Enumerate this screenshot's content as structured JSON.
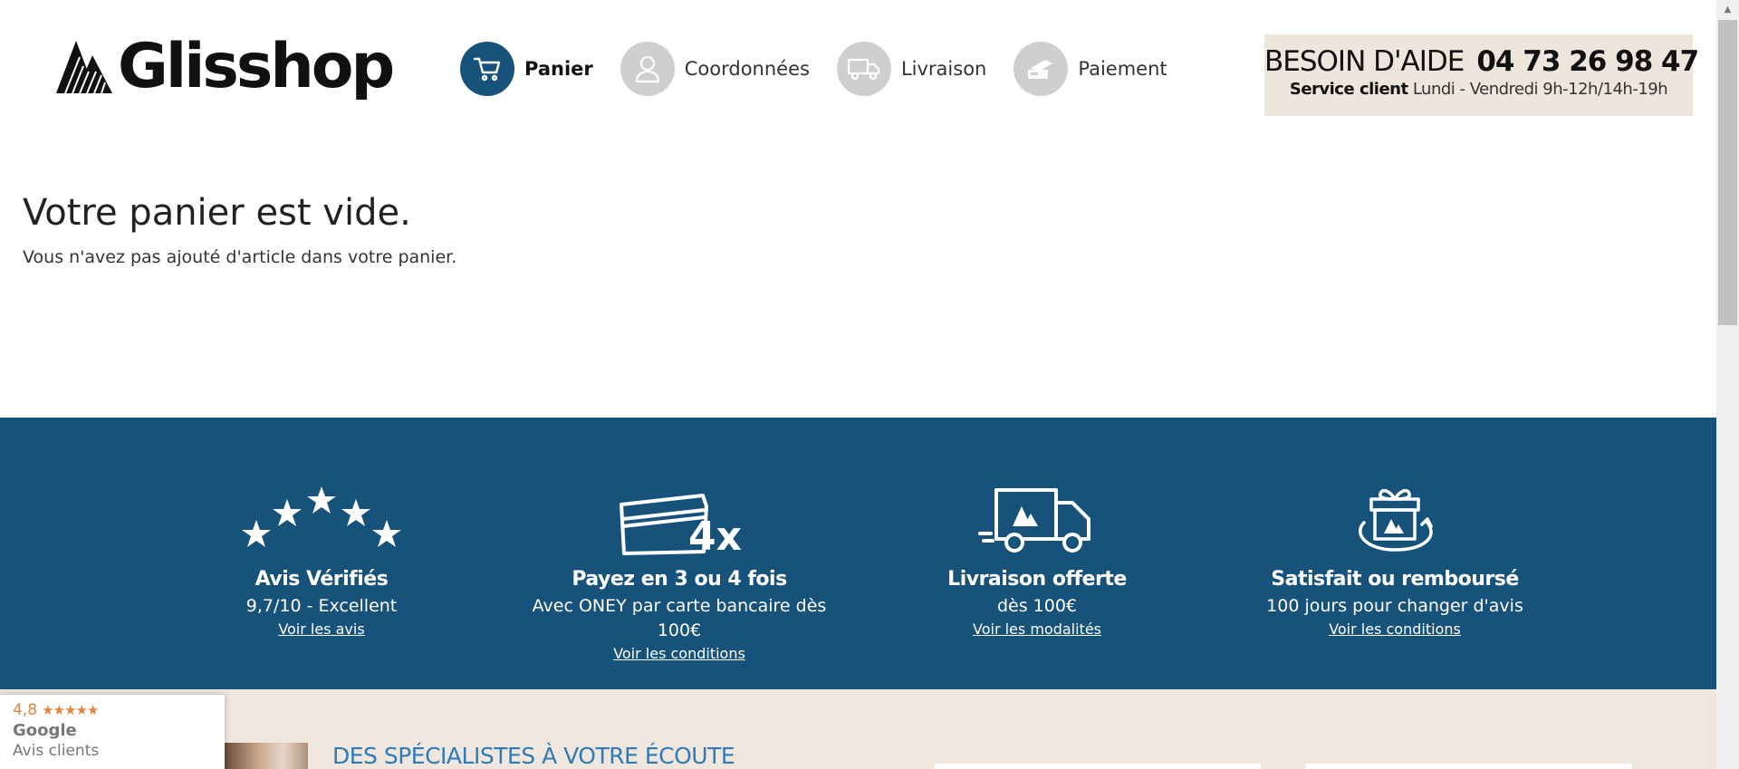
{
  "brand": {
    "name": "Glisshop"
  },
  "steps": [
    {
      "label": "Panier",
      "icon": "cart-icon",
      "active": true
    },
    {
      "label": "Coordonnées",
      "icon": "user-icon",
      "active": false
    },
    {
      "label": "Livraison",
      "icon": "truck-icon",
      "active": false
    },
    {
      "label": "Paiement",
      "icon": "card-icon",
      "active": false
    }
  ],
  "help": {
    "title": "BESOIN D'AIDE",
    "phone": "04 73 26 98 47",
    "service_label": "Service client",
    "hours": "Lundi - Vendredi 9h-12h/14h-19h"
  },
  "cart": {
    "title": "Votre panier est vide.",
    "message": "Vous n'avez pas ajouté d'article dans votre panier."
  },
  "features": [
    {
      "icon": "stars-icon",
      "title": "Avis Vérifiés",
      "desc": "9,7/10 - Excellent",
      "link": "Voir les avis"
    },
    {
      "icon": "card-4x-icon",
      "title": "Payez en 3 ou 4 fois",
      "desc": "Avec ONEY par carte bancaire dès 100€",
      "link": "Voir les conditions"
    },
    {
      "icon": "delivery-truck-icon",
      "title": "Livraison offerte",
      "desc": "dès 100€",
      "link": "Voir les modalités"
    },
    {
      "icon": "gift-return-icon",
      "title": "Satisfait ou remboursé",
      "desc": "100 jours pour changer d'avis",
      "link": "Voir les conditions"
    }
  ],
  "specialists": {
    "title": "DES SPÉCIALISTES À VOTRE ÉCOUTE"
  },
  "google_badge": {
    "rating": "4,8",
    "stars": "★★★★★",
    "brand": "Google",
    "label": "Avis clients"
  },
  "colors": {
    "primary": "#17527a",
    "beige": "#eee6dc",
    "step_inactive": "#cfcfcf",
    "link_blue": "#2f7ab8",
    "google_orange": "#e4843a"
  }
}
